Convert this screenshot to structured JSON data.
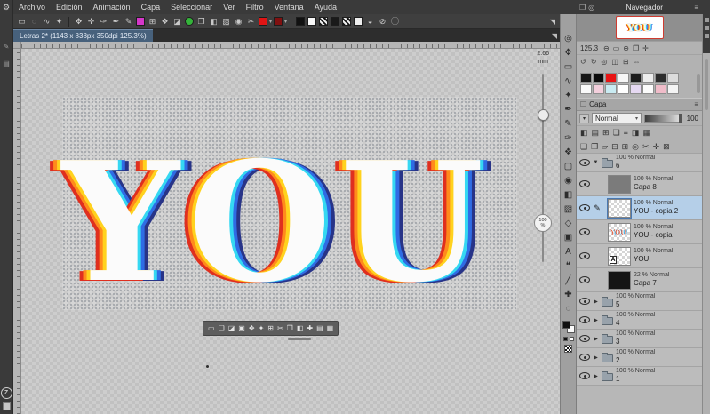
{
  "menu": {
    "items": [
      "Archivo",
      "Edición",
      "Animación",
      "Capa",
      "Seleccionar",
      "Ver",
      "Filtro",
      "Ventana",
      "Ayuda"
    ]
  },
  "toolbar": {
    "collapse_icon": "◥",
    "items": [
      {
        "id": "rect-select",
        "k": "g",
        "v": "▭"
      },
      {
        "id": "lasso-select",
        "k": "g",
        "v": "◌"
      },
      {
        "id": "polyline-select",
        "k": "g",
        "v": "∿"
      },
      {
        "id": "magic-wand",
        "k": "g",
        "v": "✦"
      },
      {
        "k": "sep"
      },
      {
        "id": "move",
        "k": "g",
        "v": "✥"
      },
      {
        "id": "navigate",
        "k": "g",
        "v": "✛"
      },
      {
        "id": "eyedropper",
        "k": "g",
        "v": "✑"
      },
      {
        "id": "pen",
        "k": "g",
        "v": "✒"
      },
      {
        "id": "pencil",
        "k": "g",
        "v": "✎"
      },
      {
        "id": "magenta-swatch",
        "k": "c",
        "v": "#d537c9"
      },
      {
        "id": "grid",
        "k": "g",
        "v": "⊞"
      },
      {
        "id": "decoration",
        "k": "g",
        "v": "❖"
      },
      {
        "id": "halfsquare",
        "k": "g",
        "v": "◪"
      },
      {
        "id": "green-swatch",
        "k": "c",
        "v": "#34b43a",
        "round": true
      },
      {
        "id": "duplicate",
        "k": "g",
        "v": "❐"
      },
      {
        "id": "fill",
        "k": "g",
        "v": "◧"
      },
      {
        "id": "gradient",
        "k": "g",
        "v": "▨"
      },
      {
        "id": "target-circle",
        "k": "g",
        "v": "◉"
      },
      {
        "id": "cut",
        "k": "g",
        "v": "✂"
      },
      {
        "id": "red-swatch",
        "k": "c",
        "v": "#e01414",
        "dd": true
      },
      {
        "id": "dark-red-swatch",
        "k": "c",
        "v": "#801010",
        "dd": true
      },
      {
        "k": "sep"
      },
      {
        "id": "black-swatch",
        "k": "c",
        "v": "#111111"
      },
      {
        "id": "white-swatch",
        "k": "c",
        "v": "#f8f8f8"
      },
      {
        "id": "pattern-swatch-1",
        "k": "pat"
      },
      {
        "id": "dark-swatch",
        "k": "c",
        "v": "#1a1a1a"
      },
      {
        "id": "pattern-swatch-2",
        "k": "pat"
      },
      {
        "id": "light-swatch",
        "k": "c",
        "v": "#ededed"
      },
      {
        "id": "contrast",
        "k": "g",
        "v": "◒"
      },
      {
        "id": "prohibit",
        "k": "g",
        "v": "⊘"
      },
      {
        "id": "info",
        "k": "g",
        "v": "ⓘ"
      }
    ]
  },
  "tabbar": {
    "tab_label": "Letras 2* (1143 x 838px 350dpi 125.3%)",
    "collapse_icon": "◥"
  },
  "canvas": {
    "artwork_text": "YOU",
    "measure_value": "2.66",
    "measure_unit": "mm",
    "zoom_badge_value": "100",
    "zoom_badge_unit": "%",
    "float_tools": [
      "▭",
      "❏",
      "◪",
      "▣",
      "✥",
      "✦",
      "⊞",
      "✂",
      "❐",
      "◧",
      "✚",
      "▤",
      "▦"
    ]
  },
  "tool_strip": {
    "tools": [
      {
        "id": "operation",
        "g": "◎"
      },
      {
        "id": "move",
        "g": "✥"
      },
      {
        "id": "marquee",
        "g": "▭"
      },
      {
        "id": "lasso",
        "g": "∿"
      },
      {
        "id": "wand",
        "g": "✦"
      },
      {
        "id": "pen",
        "g": "✒"
      },
      {
        "id": "pencil",
        "g": "✎"
      },
      {
        "id": "brush",
        "g": "✑"
      },
      {
        "id": "decoration",
        "g": "❖"
      },
      {
        "id": "eraser",
        "g": "▢"
      },
      {
        "id": "blend",
        "g": "◉"
      },
      {
        "id": "fill",
        "g": "◧"
      },
      {
        "id": "gradient",
        "g": "▨"
      },
      {
        "id": "figure",
        "g": "◇"
      },
      {
        "id": "frame",
        "g": "▣"
      },
      {
        "id": "text",
        "g": "A"
      },
      {
        "id": "balloon",
        "g": "❝"
      },
      {
        "id": "line",
        "g": "╱"
      },
      {
        "id": "correction",
        "g": "✚"
      },
      {
        "id": "lightcircle",
        "g": "◌"
      }
    ]
  },
  "navigator": {
    "title": "Navegador",
    "menu_icon": "≡",
    "tab_icons": [
      "❐",
      "◎"
    ],
    "zoom_value": "125.3",
    "zoom_icons": [
      {
        "id": "zoom-out",
        "g": "⊖"
      },
      {
        "id": "zoom-slider",
        "g": "▭"
      },
      {
        "id": "zoom-in",
        "g": "⊕"
      },
      {
        "id": "fit-screen",
        "g": "❐"
      },
      {
        "id": "actual-size",
        "g": "✛"
      }
    ],
    "transform_icons": [
      {
        "id": "rotate-left",
        "g": "↺"
      },
      {
        "id": "rotate-right",
        "g": "↻"
      },
      {
        "id": "reset-rotation",
        "g": "◎"
      },
      {
        "id": "flip-horizontal",
        "g": "◫"
      },
      {
        "id": "flip-vertical",
        "g": "⊟"
      },
      {
        "id": "reset-view",
        "g": "⇔"
      }
    ],
    "swatch_rows": [
      [
        "#161616",
        "#0b0b0b",
        "#e81414",
        "#f6f6f6",
        "#1c1c1c",
        "#ededed",
        "#2c2c2c",
        "#dcdcdc"
      ],
      [
        "#fafafa",
        "#f3cfdc",
        "#c9ebf2",
        "#ffffff",
        "#e6d9f2",
        "#fbfbfb",
        "#f0bcc9",
        "#f4f4f4"
      ]
    ]
  },
  "layers": {
    "title": "Capa",
    "panel_icon": "❏",
    "menu_icon": "≡",
    "blend_mode": "Normal",
    "blend_caret": "▾",
    "opacity_value": "100",
    "text_badge": "A",
    "toolbar_row1": [
      {
        "id": "palette-a",
        "g": "◧"
      },
      {
        "id": "palette-b",
        "g": "▤"
      },
      {
        "id": "palette-c",
        "g": "⊞"
      },
      {
        "id": "palette-d",
        "g": "❏"
      },
      {
        "id": "palette-e",
        "g": "≡"
      },
      {
        "id": "palette-f",
        "g": "◨"
      },
      {
        "id": "palette-g",
        "g": "▦"
      }
    ],
    "toolbar_row2": [
      {
        "id": "new-raster-layer",
        "g": "❏"
      },
      {
        "id": "new-vector-layer",
        "g": "❐"
      },
      {
        "id": "new-folder",
        "g": "▱"
      },
      {
        "id": "transfer-down",
        "g": "⊟"
      },
      {
        "id": "merge-down",
        "g": "⊞"
      },
      {
        "id": "layer-mask",
        "g": "◎"
      },
      {
        "id": "apply-mask",
        "g": "✂"
      },
      {
        "id": "ruler",
        "g": "✛"
      },
      {
        "id": "delete-layer",
        "g": "⊠"
      }
    ],
    "items": [
      {
        "kind": "folder",
        "opacity": "100 % Normal",
        "name": "6",
        "expanded": true
      },
      {
        "kind": "layer",
        "opacity": "100 % Normal",
        "name": "Capa 8",
        "thumb": "gray",
        "indent": true
      },
      {
        "kind": "layer",
        "opacity": "100 % Normal",
        "name": "YOU - copia 2",
        "thumb": "checker",
        "selected": true,
        "indent": true
      },
      {
        "kind": "layer",
        "opacity": "100 % Normal",
        "name": "YOU - copia",
        "thumb": "you",
        "indent": true
      },
      {
        "kind": "layer",
        "opacity": "100 % Normal",
        "name": "YOU",
        "thumb": "text",
        "indent": true
      },
      {
        "kind": "layer",
        "opacity": "22 % Normal",
        "name": "Capa 7",
        "thumb": "black",
        "indent": true
      },
      {
        "kind": "folder",
        "opacity": "100 % Normal",
        "name": "5"
      },
      {
        "kind": "folder",
        "opacity": "100 % Normal",
        "name": "4"
      },
      {
        "kind": "folder",
        "opacity": "100 % Normal",
        "name": "3"
      },
      {
        "kind": "folder",
        "opacity": "100 % Normal",
        "name": "2"
      },
      {
        "kind": "folder",
        "opacity": "100 % Normal",
        "name": "1"
      }
    ]
  },
  "left_strip": {
    "gear_icon": "⚙",
    "icons": [
      "✎",
      "▤"
    ],
    "logo_letter": "Z"
  }
}
